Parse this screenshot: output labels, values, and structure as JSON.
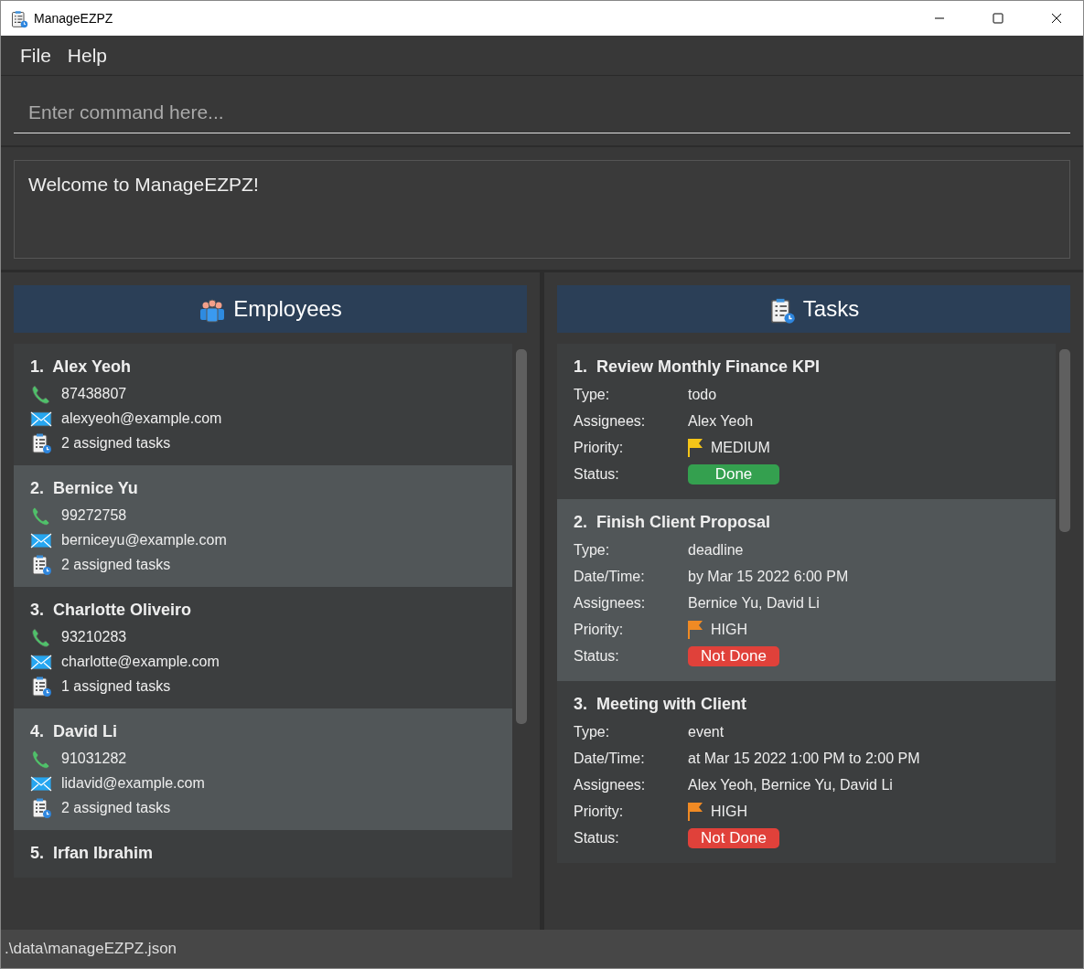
{
  "window": {
    "title": "ManageEZPZ"
  },
  "menu": [
    "File",
    "Help"
  ],
  "command_box": {
    "placeholder": "Enter command here..."
  },
  "result_display": "Welcome to ManageEZPZ!",
  "employees": {
    "title": "Employees",
    "items": [
      {
        "index": "1.",
        "name": "Alex Yeoh",
        "phone": "87438807",
        "email": "alexyeoh@example.com",
        "tasks": "2 assigned tasks"
      },
      {
        "index": "2.",
        "name": "Bernice Yu",
        "phone": "99272758",
        "email": "berniceyu@example.com",
        "tasks": "2 assigned tasks"
      },
      {
        "index": "3.",
        "name": "Charlotte Oliveiro",
        "phone": "93210283",
        "email": "charlotte@example.com",
        "tasks": "1 assigned tasks"
      },
      {
        "index": "4.",
        "name": "David Li",
        "phone": "91031282",
        "email": "lidavid@example.com",
        "tasks": "2 assigned tasks"
      },
      {
        "index": "5.",
        "name": "Irfan Ibrahim"
      }
    ]
  },
  "tasks": {
    "title": "Tasks",
    "items": [
      {
        "index": "1.",
        "name": "Review Monthly Finance KPI",
        "fields": [
          {
            "kind": "text",
            "label": "Type:",
            "value": "todo"
          },
          {
            "kind": "text",
            "label": "Assignees:",
            "value": "Alex Yeoh"
          },
          {
            "kind": "priority",
            "label": "Priority:",
            "value": "MEDIUM",
            "color": "#f5c518"
          },
          {
            "kind": "status",
            "label": "Status:",
            "value": "Done",
            "done": true
          }
        ]
      },
      {
        "index": "2.",
        "name": "Finish Client Proposal",
        "fields": [
          {
            "kind": "text",
            "label": "Type:",
            "value": "deadline"
          },
          {
            "kind": "text",
            "label": "Date/Time:",
            "value": "by Mar 15 2022 6:00 PM"
          },
          {
            "kind": "text",
            "label": "Assignees:",
            "value": "Bernice Yu, David Li"
          },
          {
            "kind": "priority",
            "label": "Priority:",
            "value": "HIGH",
            "color": "#f08a24"
          },
          {
            "kind": "status",
            "label": "Status:",
            "value": "Not Done",
            "done": false
          }
        ]
      },
      {
        "index": "3.",
        "name": "Meeting with Client",
        "fields": [
          {
            "kind": "text",
            "label": "Type:",
            "value": "event"
          },
          {
            "kind": "text",
            "label": "Date/Time:",
            "value": "at Mar 15 2022 1:00 PM to 2:00 PM"
          },
          {
            "kind": "text",
            "label": "Assignees:",
            "value": "Alex Yeoh, Bernice Yu, David Li"
          },
          {
            "kind": "priority",
            "label": "Priority:",
            "value": "HIGH",
            "color": "#f08a24"
          },
          {
            "kind": "status",
            "label": "Status:",
            "value": "Not Done",
            "done": false
          }
        ]
      }
    ]
  },
  "status_bar": ".\\data\\manageEZPZ.json"
}
